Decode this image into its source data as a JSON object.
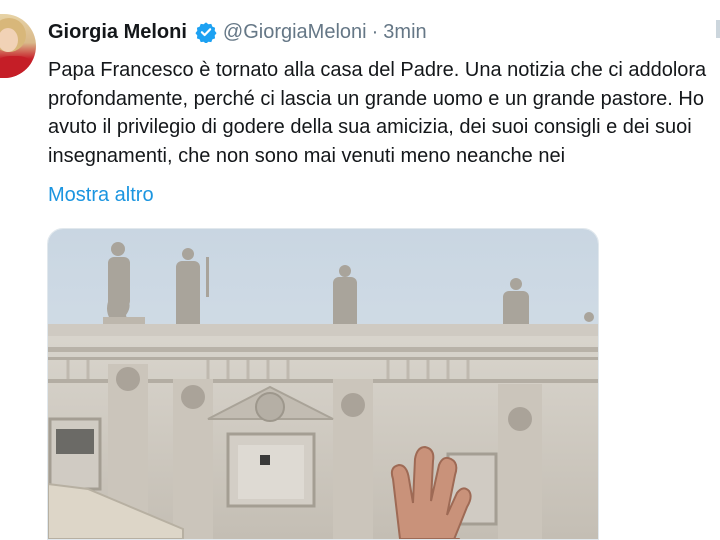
{
  "tweet": {
    "author_name": "Giorgia Meloni",
    "handle": "@GiorgiaMeloni",
    "separator": "·",
    "time": "3min",
    "text_lines": [
      "Papa Francesco è tornato alla casa del Padre. Una notizia che ci addolora",
      "profondamente, perché ci lascia un grande uomo e un grande pastore. Ho",
      "avuto il privilegio di godere della sua amicizia, dei suoi consigli e dei suoi",
      "insegnamenti, che non sono mai venuti meno neanche nei"
    ],
    "show_more": "Mostra altro"
  },
  "icons": {
    "verified": "verified-badge-icon",
    "avatar": "profile-avatar"
  },
  "colors": {
    "name": "#14171a",
    "secondary": "#657786",
    "link": "#1b95e0",
    "verified_badge": "#1da1f2"
  }
}
